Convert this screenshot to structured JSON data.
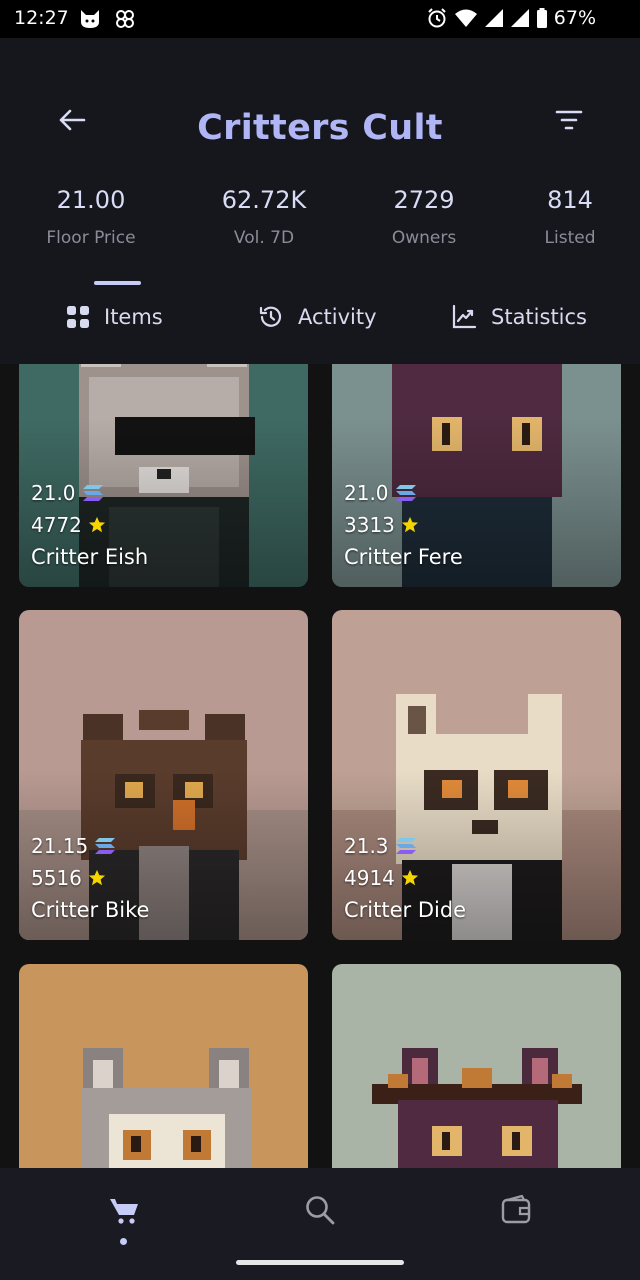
{
  "status_bar": {
    "time": "12:27",
    "battery": "67%",
    "icons": [
      "cat-notification-icon",
      "pinwheel-icon",
      "alarm-icon",
      "wifi-icon",
      "signal-icon",
      "signal-icon",
      "battery-icon"
    ]
  },
  "header": {
    "title": "Critters Cult",
    "back_icon": "arrow-left-icon",
    "filter_icon": "filter-icon"
  },
  "stats": [
    {
      "value": "21.00",
      "label": "Floor Price"
    },
    {
      "value": "62.72K",
      "label": "Vol. 7D"
    },
    {
      "value": "2729",
      "label": "Owners"
    },
    {
      "value": "814",
      "label": "Listed"
    }
  ],
  "tabs": [
    {
      "label": "Items",
      "icon": "grid-icon",
      "selected": true
    },
    {
      "label": "Activity",
      "icon": "history-icon",
      "selected": false
    },
    {
      "label": "Statistics",
      "icon": "chart-icon",
      "selected": false
    }
  ],
  "items": [
    {
      "price": "21.0",
      "rank": "4772",
      "name": "Critter Eish",
      "bg": "#3f6a63"
    },
    {
      "price": "21.0",
      "rank": "3313",
      "name": "Critter Fere",
      "bg": "#7b9190"
    },
    {
      "price": "21.15",
      "rank": "5516",
      "name": "Critter Bike",
      "bg": "#b89a92"
    },
    {
      "price": "21.3",
      "rank": "4914",
      "name": "Critter Dide",
      "bg": "#bea194"
    },
    {
      "price": "",
      "rank": "",
      "name": "",
      "bg": "#c8965c"
    },
    {
      "price": "",
      "rank": "",
      "name": "",
      "bg": "#a9b3a6"
    }
  ],
  "colors": {
    "accent": "#b0b5f5",
    "background": "#121212",
    "star": "#f5d400",
    "solana_top": "#9ad0f0",
    "solana_bottom": "#8a5cf0"
  },
  "bottom_nav": [
    {
      "icon": "cart-icon",
      "active": true
    },
    {
      "icon": "search-icon",
      "active": false
    },
    {
      "icon": "wallet-icon",
      "active": false
    }
  ]
}
